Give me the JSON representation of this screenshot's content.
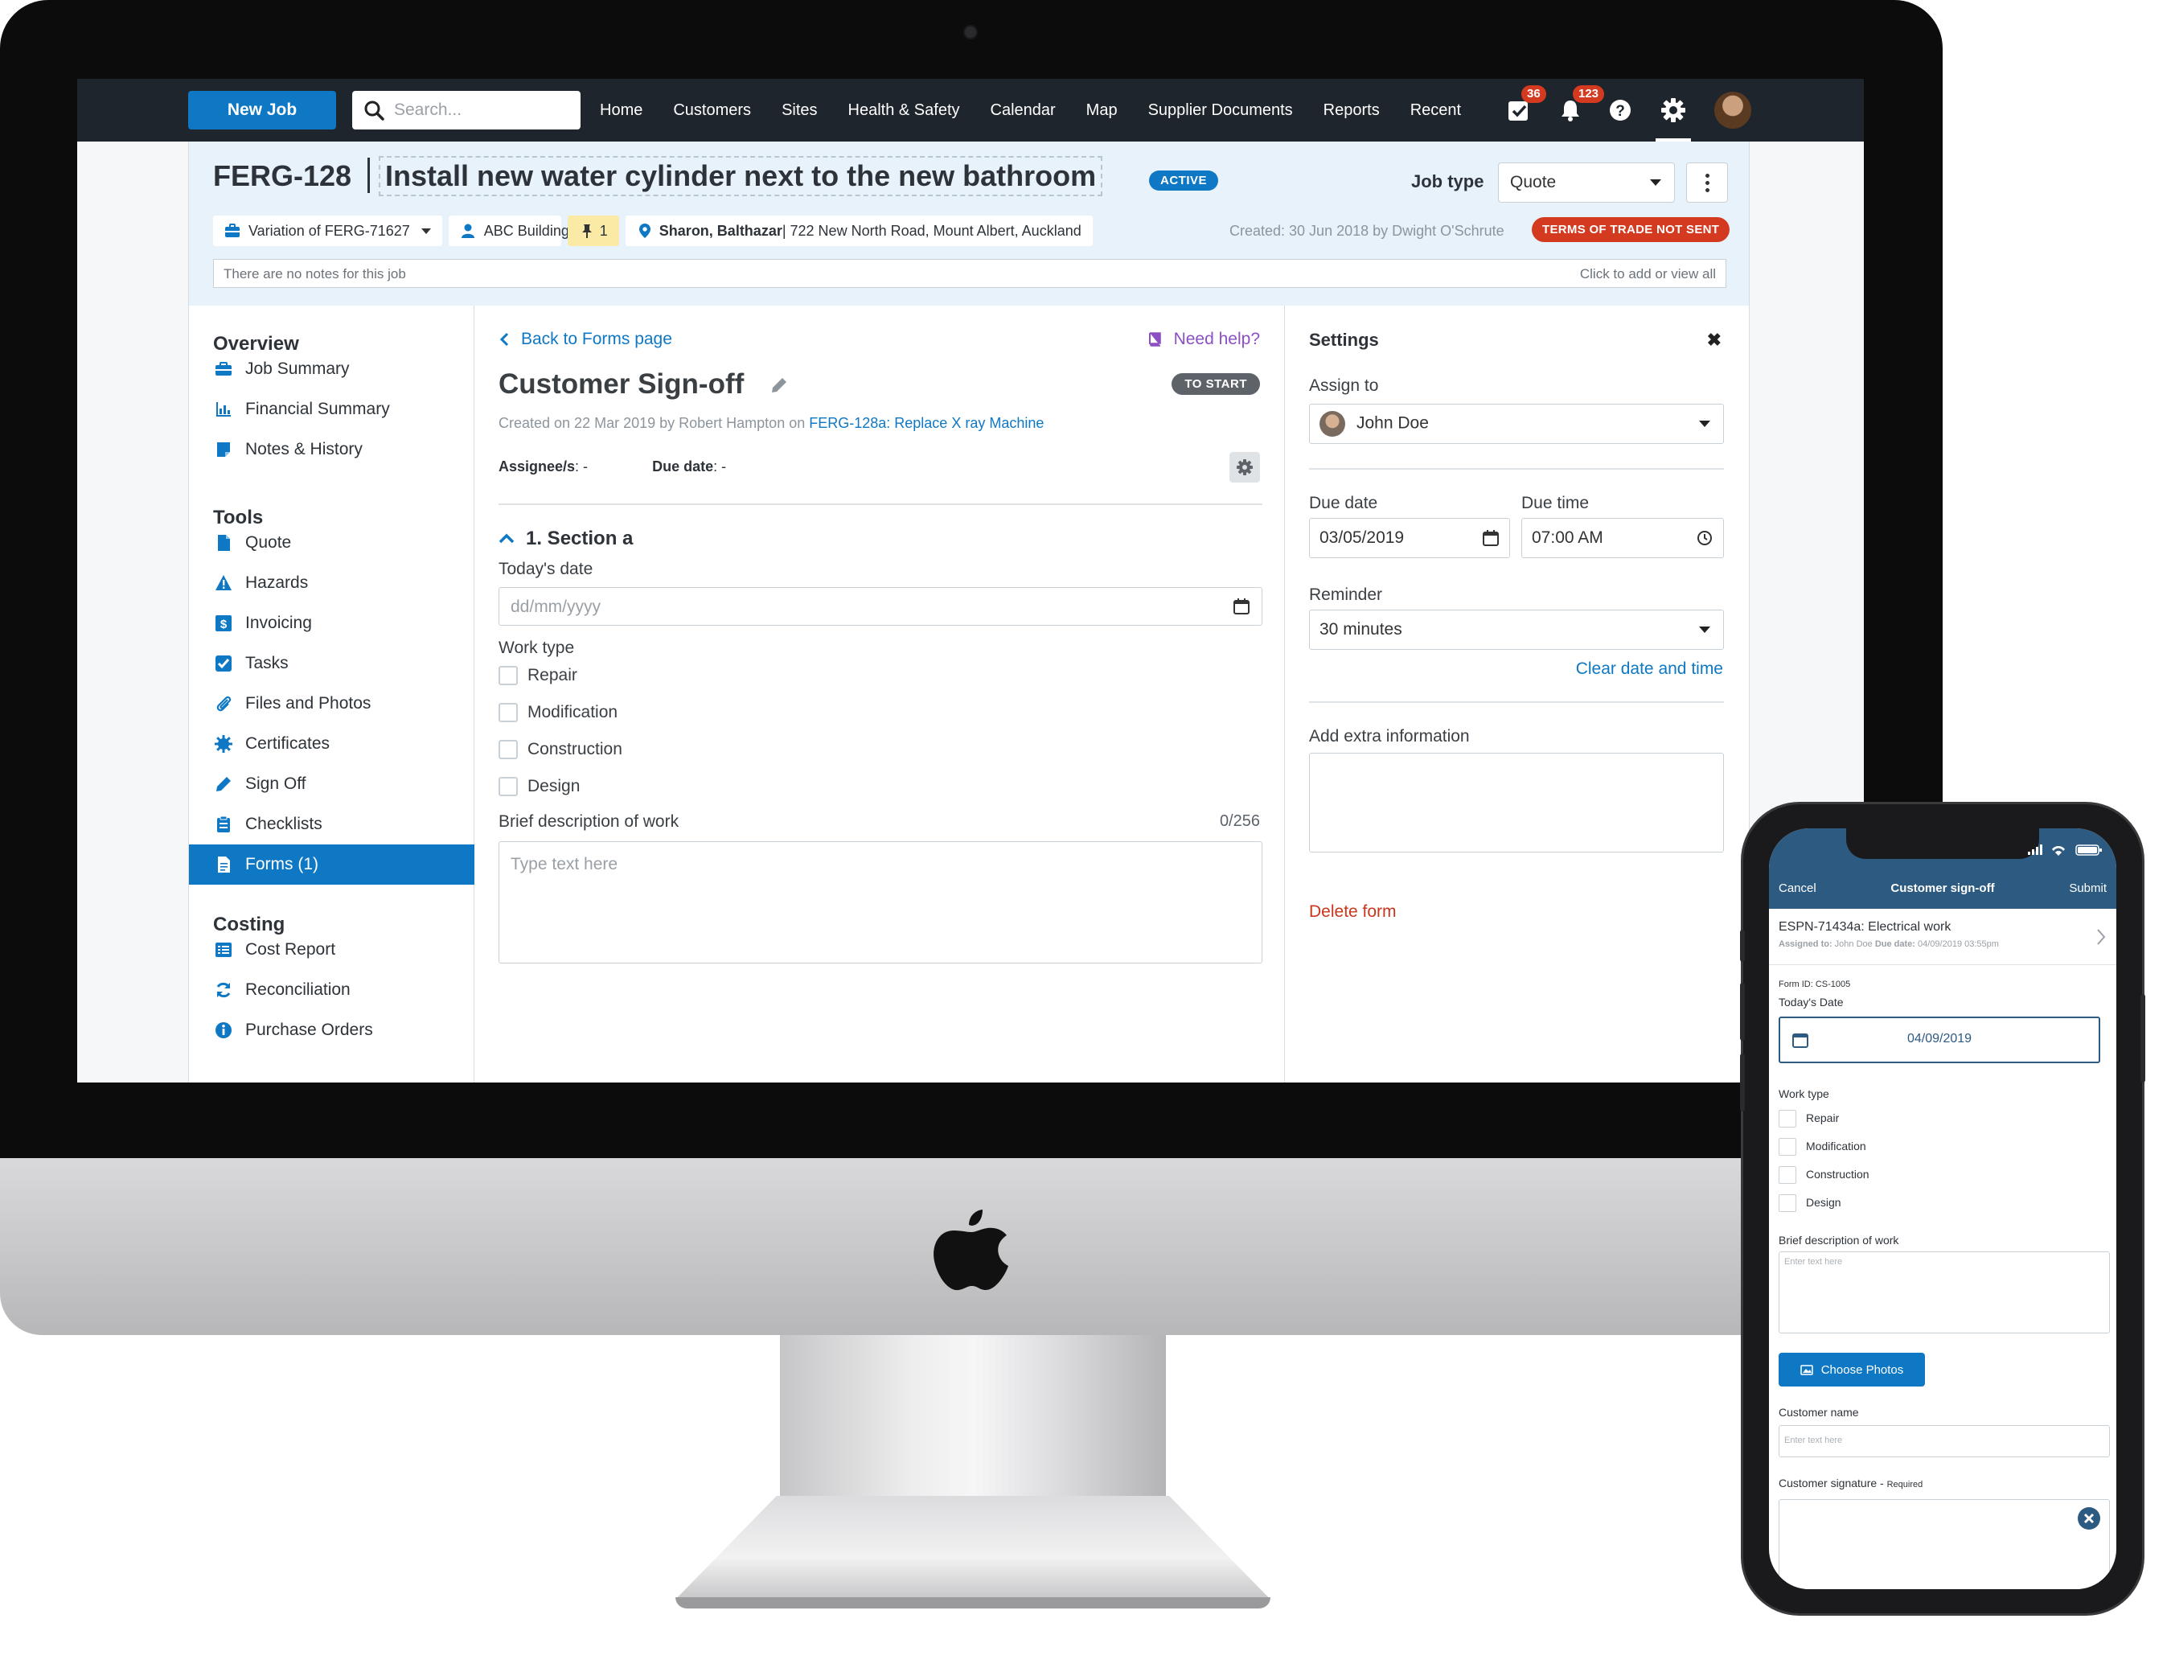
{
  "topnav": {
    "new_job": "New Job",
    "search_placeholder": "Search...",
    "links": [
      "Home",
      "Customers",
      "Sites",
      "Health & Safety",
      "Calendar",
      "Map",
      "Supplier Documents",
      "Reports",
      "Recent"
    ],
    "tasks_badge": "36",
    "notifications_badge": "123"
  },
  "job": {
    "id": "FERG-128",
    "title": "Install new water cylinder next to the new bathroom",
    "status": "ACTIVE",
    "job_type_label": "Job type",
    "job_type_value": "Quote",
    "variation": "Variation of FERG-71627",
    "building": "ABC Building",
    "pin_count": "1",
    "contact_name": "Sharon, Balthazar",
    "address": " | 722 New North Road, Mount Albert, Auckland",
    "created": "Created: 30 Jun 2018 by Dwight O'Schrute",
    "terms": "TERMS OF TRADE NOT SENT",
    "notes_placeholder": "There are no notes for this job",
    "notes_link": "Click to add or view all"
  },
  "sidebar": {
    "overview_title": "Overview",
    "overview": [
      "Job Summary",
      "Financial Summary",
      "Notes & History"
    ],
    "tools_title": "Tools",
    "tools": [
      "Quote",
      "Hazards",
      "Invoicing",
      "Tasks",
      "Files and Photos",
      "Certificates",
      "Sign Off",
      "Checklists",
      "Forms (1)"
    ],
    "costing_title": "Costing",
    "costing": [
      "Cost Report",
      "Reconciliation",
      "Purchase Orders"
    ]
  },
  "form": {
    "back": "Back to Forms page",
    "help": "Need help?",
    "title": "Customer Sign-off",
    "status": "TO START",
    "meta_prefix": "Created on 22 Mar 2019 by Robert Hampton on ",
    "meta_link": "FERG-128a: Replace X ray Machine",
    "assignee_label": "Assignee/s",
    "assignee_value": ": -",
    "due_label": "Due date",
    "due_value": ": -",
    "section": "1. Section a",
    "todays_date_label": "Today's date",
    "date_placeholder": "dd/mm/yyyy",
    "work_type_label": "Work type",
    "work_types": [
      "Repair",
      "Modification",
      "Construction",
      "Design"
    ],
    "brief_label": "Brief description of work",
    "brief_counter": "0/256",
    "brief_placeholder": "Type text here"
  },
  "settings": {
    "title": "Settings",
    "assign_label": "Assign to",
    "assignee": "John Doe",
    "due_date_label": "Due date",
    "due_date": "03/05/2019",
    "due_time_label": "Due time",
    "due_time": "07:00 AM",
    "reminder_label": "Reminder",
    "reminder": "30 minutes",
    "clear": "Clear date and time",
    "extra_label": "Add extra information",
    "delete": "Delete form"
  },
  "phone": {
    "cancel": "Cancel",
    "title": "Customer sign-off",
    "submit": "Submit",
    "job_title": "ESPN-71434a: Electrical work",
    "assigned_label": "Assigned to:",
    "assigned_value": " John Doe ",
    "due_label": "Due date:",
    "due_value": " 04/09/2019 03:55pm",
    "form_id": "Form ID: CS-1005",
    "todays_date_label": "Today's Date",
    "todays_date": "04/09/2019",
    "work_type_label": "Work type",
    "work_types": [
      "Repair",
      "Modification",
      "Construction",
      "Design"
    ],
    "brief_label": "Brief description of work",
    "enter_text": "Enter text here",
    "choose_photos": "Choose Photos",
    "customer_name_label": "Customer name",
    "signature_label": "Customer signature - ",
    "required": "Required"
  },
  "colors": {
    "primary": "#0e78c4",
    "nav_bg": "#1f252d",
    "header_bg": "#e7f2fa",
    "danger": "#d33a20",
    "phone_header": "#2d5a80"
  },
  "icons": [
    "search-icon",
    "tasks-icon",
    "bell-icon",
    "help-icon",
    "gear-icon",
    "briefcase-icon",
    "user-icon",
    "pin-icon",
    "location-icon",
    "chevron-left-icon",
    "book-icon",
    "pencil-icon",
    "chevron-up-icon",
    "calendar-icon",
    "clock-icon",
    "close-icon",
    "photo-icon",
    "apple-logo"
  ]
}
